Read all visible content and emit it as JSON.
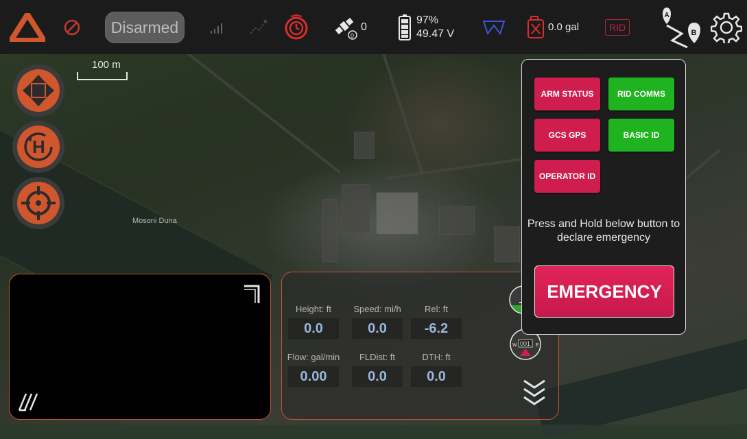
{
  "toolbar": {
    "arm_state": "Disarmed",
    "satellite_count": "0",
    "battery_percent": "97%",
    "battery_voltage": "49.47 V",
    "tank_level": "0.0 gal",
    "rid_label": "RID",
    "route_start": "A",
    "route_end": "B"
  },
  "map": {
    "scale_label": "100 m",
    "place_label": "Mosoni Duna"
  },
  "telemetry": {
    "height": {
      "label": "Height: ft",
      "value": "0.0"
    },
    "speed": {
      "label": "Speed: mi/h",
      "value": "0.0"
    },
    "rel": {
      "label": "Rel: ft",
      "value": "-6.2"
    },
    "flow": {
      "label": "Flow: gal/min",
      "value": "0.00"
    },
    "fldist": {
      "label": "FLDist: ft",
      "value": "0.0"
    },
    "dth": {
      "label": "DTH: ft",
      "value": "0.0"
    },
    "compass_heading": "001",
    "compass_w": "W",
    "compass_e": "E"
  },
  "rid_panel": {
    "buttons": [
      {
        "label": "ARM STATUS",
        "status": "red"
      },
      {
        "label": "RID COMMS",
        "status": "green"
      },
      {
        "label": "GCS GPS",
        "status": "red"
      },
      {
        "label": "BASIC ID",
        "status": "green"
      },
      {
        "label": "OPERATOR ID",
        "status": "red"
      }
    ],
    "message": "Press and Hold below button to declare emergency",
    "emergency_label": "EMERGENCY"
  },
  "colors": {
    "accent_orange": "#d0572d",
    "status_red": "#cf1e4e",
    "status_green": "#1fb41f",
    "value_blue": "#9ab8d8"
  }
}
